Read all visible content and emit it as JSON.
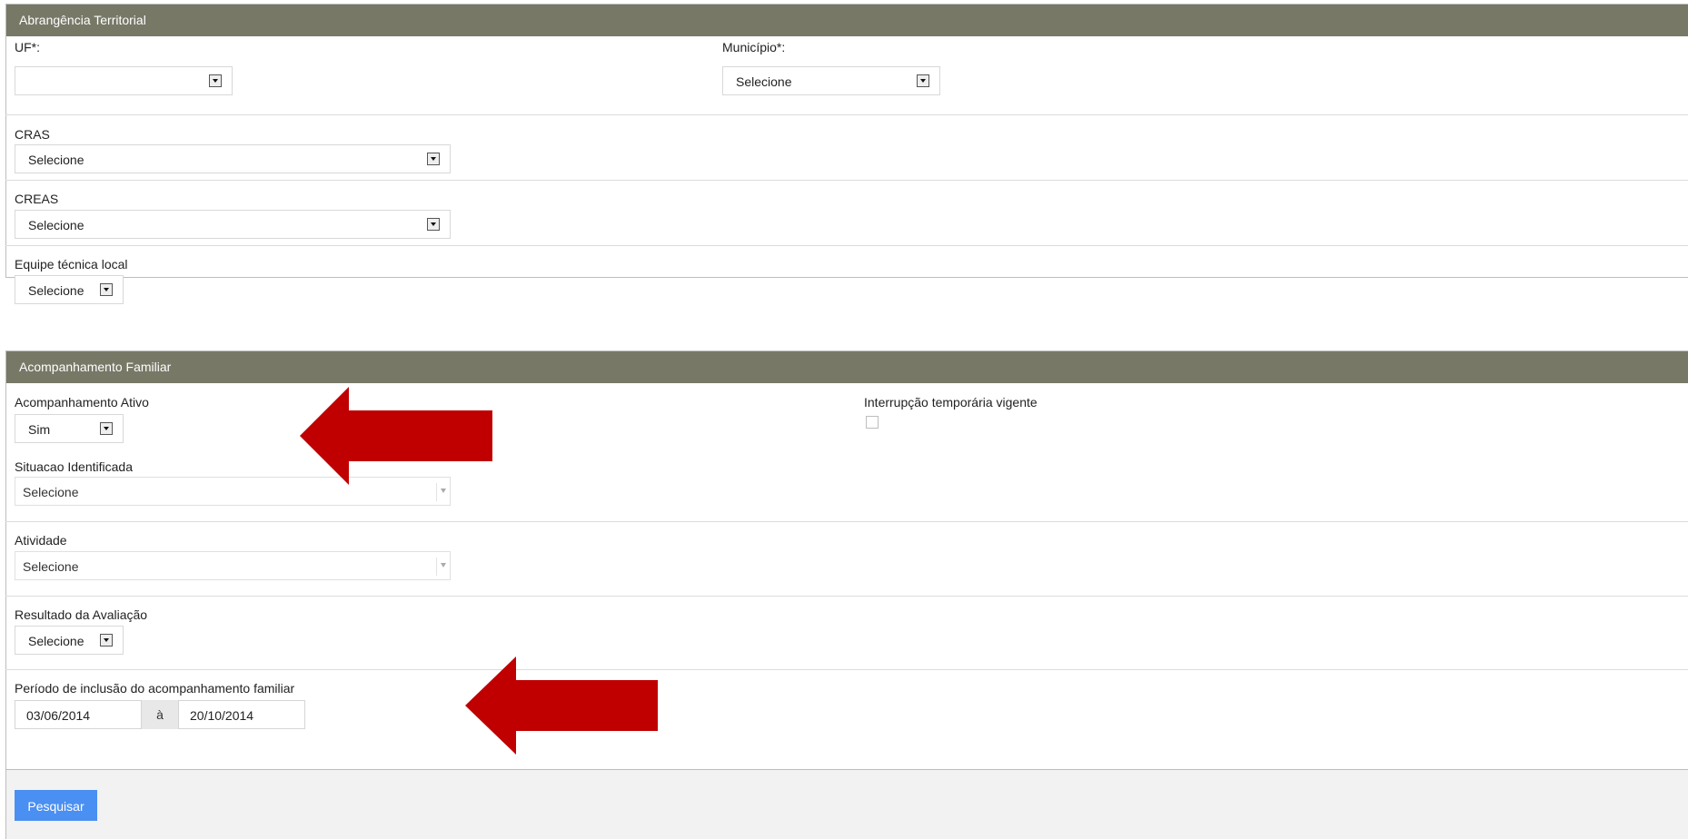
{
  "territorial": {
    "header": "Abrangência Territorial",
    "uf_label": "UF*:",
    "uf_value": "",
    "municipio_label": "Município*:",
    "municipio_value": "Selecione",
    "cras_label": "CRAS",
    "cras_value": "Selecione",
    "creas_label": "CREAS",
    "creas_value": "Selecione",
    "equipe_label": "Equipe técnica local",
    "equipe_value": "Selecione"
  },
  "familiar": {
    "header": "Acompanhamento Familiar",
    "ativo_label": "Acompanhamento Ativo",
    "ativo_value": "Sim",
    "interrupcao_label": "Interrupção temporária vigente",
    "situacao_label": "Situacao Identificada",
    "situacao_placeholder": "Selecione",
    "atividade_label": "Atividade",
    "atividade_placeholder": "Selecione",
    "resultado_label": "Resultado da Avaliação",
    "resultado_value": "Selecione",
    "periodo_label": "Período de inclusão do acompanhamento familiar",
    "periodo_inicio": "03/06/2014",
    "periodo_sep": "à",
    "periodo_fim": "20/10/2014"
  },
  "actions": {
    "search_label": "Pesquisar"
  },
  "annotations": {
    "arrow_color": "#c00000"
  }
}
